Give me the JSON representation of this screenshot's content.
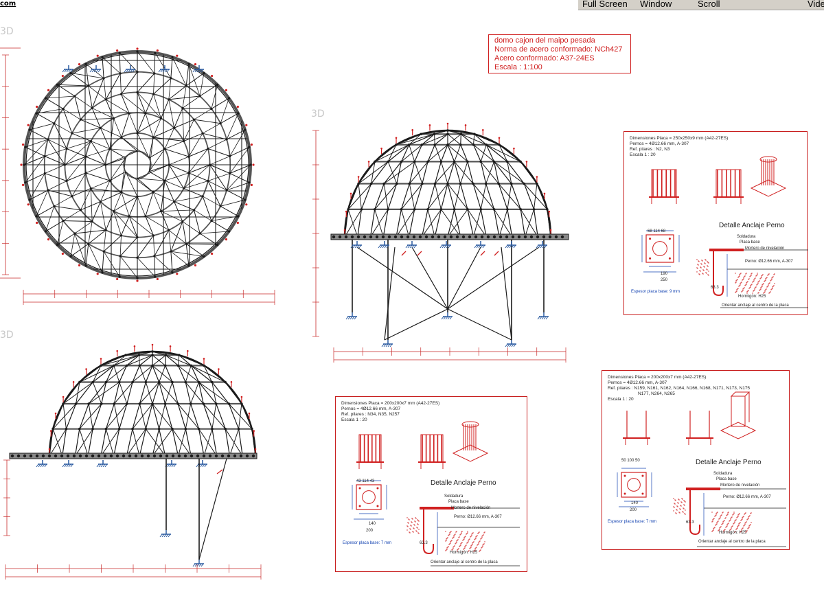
{
  "menu": {
    "full_screen": "Full Screen",
    "window": "Window",
    "scroll": "Scroll",
    "video": "Vide"
  },
  "corner_text": "com",
  "view_tags": {
    "tl": "3D",
    "mid": "3D",
    "bl": "3D"
  },
  "title_block": {
    "line1": "domo cajon del maipo pesada",
    "line2": "Norma de acero conformado: NCh427",
    "line3": "Acero conformado:  A37-24ES",
    "line4": "Escala : 1:100"
  },
  "details": [
    {
      "dims": "Dimensiones Placa = 250x250x9 mm (A42-27ES)",
      "pernos": "Pernos = 4Ø12.66 mm, A-307",
      "pilares": "Ref. pilares :  N2, N3",
      "pilares2": "",
      "escala": "Escala 1 : 20",
      "title": "Detalle Anclaje Perno",
      "top_dims": "68   114   68",
      "plate_w": "190",
      "plate_w2": "250",
      "espesor": "Espesor placa base: 9 mm",
      "soldadura": "Soldadura",
      "placa_base": "Placa base",
      "mortero": "Mortero de nivelación",
      "perno": "Perno: Ø12.66 mm, A-307",
      "hormigon": "Hormigón: H25",
      "orientar": "Orientar anclaje al centro de la placa",
      "hook": "63.3"
    },
    {
      "dims": "Dimensiones Placa = 200x200x7 mm (A42-27ES)",
      "pernos": "Pernos = 4Ø12.66 mm, A-307",
      "pilares": "Ref. pilares :  N34, N35, N257",
      "pilares2": "",
      "escala": "Escala 1 : 20",
      "title": "Detalle Anclaje Perno",
      "top_dims": "43   114   43",
      "plate_w": "140",
      "plate_w2": "200",
      "espesor": "Espesor placa base: 7 mm",
      "soldadura": "Soldadura",
      "placa_base": "Placa base",
      "mortero": "Mortero de nivelación",
      "perno": "Perno: Ø12.66 mm, A-307",
      "hormigon": "Hormigón: H25",
      "orientar": "Orientar anclaje al centro de la placa",
      "hook": "63.3"
    },
    {
      "dims": "Dimensiones Placa = 200x200x7 mm (A42-27ES)",
      "pernos": "Pernos = 4Ø12.66 mm, A-307",
      "pilares": "Ref. pilares :  N159, N161, N162, N164, N166, N168, N171, N173, N175",
      "pilares2": "N177, N264, N265",
      "escala": "Escala 1 : 20",
      "title": "Detalle Anclaje Perno",
      "top_dims": "50   100   50",
      "plate_w": "140",
      "plate_w2": "200",
      "espesor": "Espesor placa base: 7 mm",
      "soldadura": "Soldadura",
      "placa_base": "Placa base",
      "mortero": "Mortero de nivelación",
      "perno": "Perno: Ø12.66 mm, A-307",
      "hormigon": "Hormigón: H25",
      "orientar": "Orientar anclaje al centro de la placa",
      "hook": "63.3"
    }
  ],
  "colors": {
    "line": "#1a1a1a",
    "red": "#d02020",
    "dim": "#c82828",
    "support": "#2a5aa0",
    "member": "#555555"
  }
}
